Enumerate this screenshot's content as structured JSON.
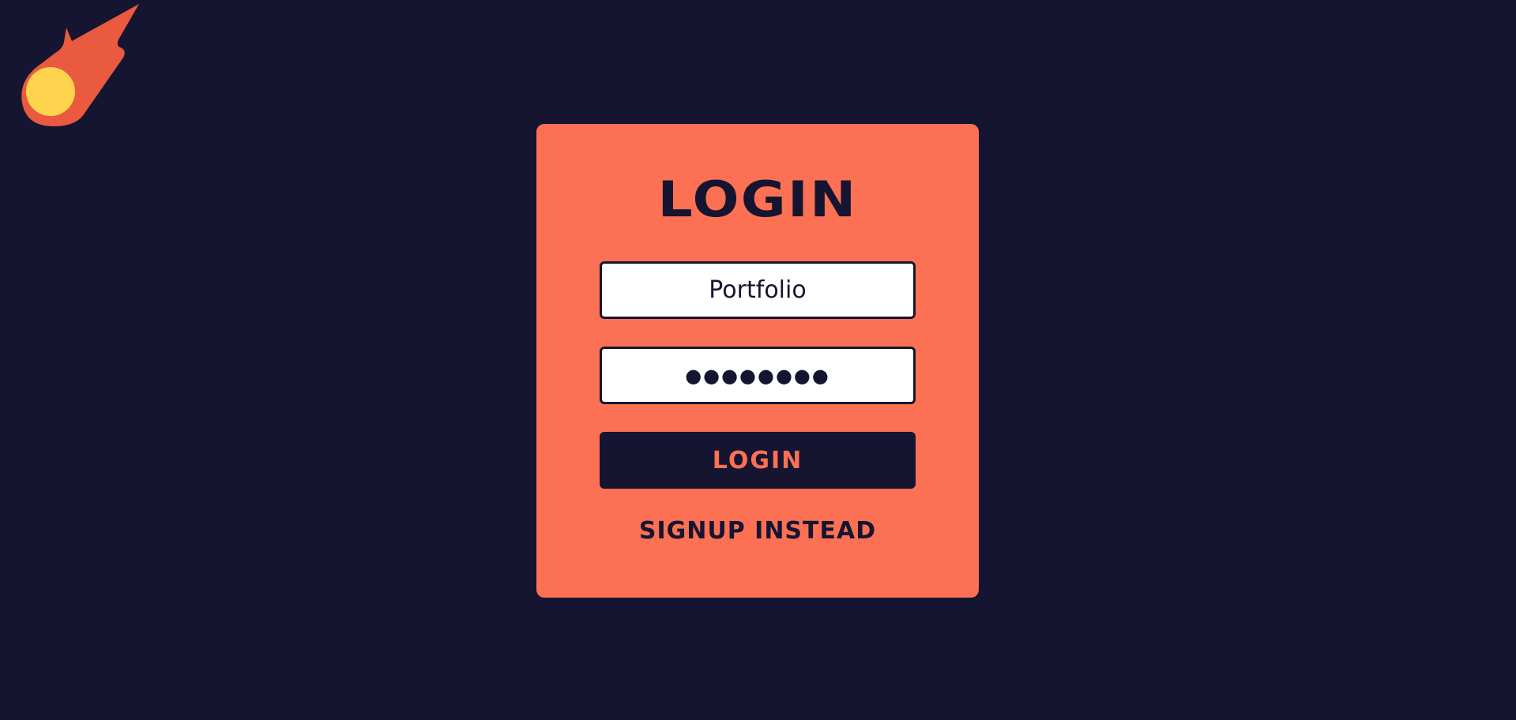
{
  "logo": {
    "icon": "comet-icon"
  },
  "login_card": {
    "title": "LOGIN",
    "username": {
      "value": "Portfolio",
      "placeholder": ""
    },
    "password": {
      "value": "●●●●●●●●",
      "placeholder": ""
    },
    "submit_label": "LOGIN",
    "signup_label": "SIGNUP INSTEAD"
  },
  "colors": {
    "background": "#151531",
    "card": "#fc7053",
    "text_dark": "#151531",
    "comet_tail": "#ea5a3e",
    "comet_core": "#ffd34e"
  }
}
